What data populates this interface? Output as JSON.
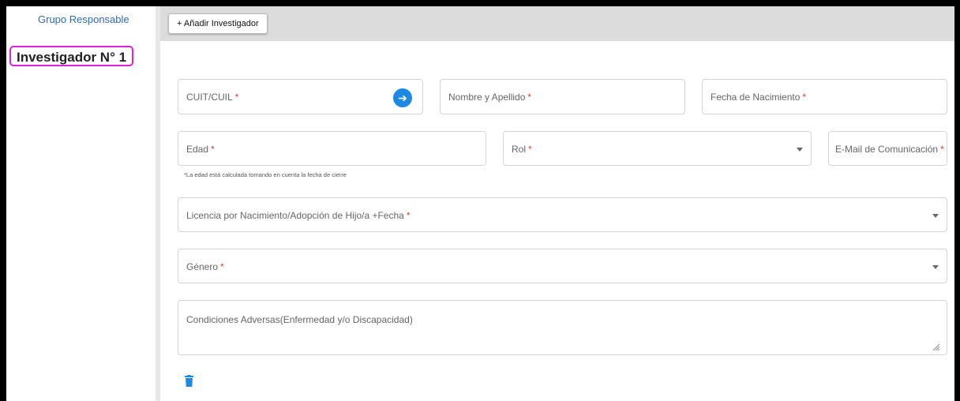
{
  "sidebar": {
    "link_label": "Grupo Responsable"
  },
  "toolbar": {
    "add_label": "+ Añadir Investigador"
  },
  "section": {
    "title": "Investigador N° 1"
  },
  "fields": {
    "cuit": {
      "label": "CUIT/CUIL",
      "required_mark": "*"
    },
    "nombre": {
      "label": "Nombre y Apellido",
      "required_mark": "*"
    },
    "fecha_nac": {
      "label": "Fecha de Nacimiento",
      "required_mark": "*"
    },
    "edad": {
      "label": "Edad",
      "required_mark": "*",
      "hint": "*La edad está calculada tomando en cuenta la fecha de cierre"
    },
    "rol": {
      "label": "Rol",
      "required_mark": "*"
    },
    "email": {
      "label": "E-Mail de Comunicación",
      "required_mark": "*"
    },
    "licencia": {
      "label": "Licencia por Nacimiento/Adopción de Hijo/a +Fecha",
      "required_mark": "*"
    },
    "genero": {
      "label": "Género",
      "required_mark": "*"
    },
    "condiciones": {
      "label": "Condiciones Adversas(Enfermedad y/o Discapacidad)"
    }
  },
  "icons": {
    "arrow": "arrow-right-icon",
    "dropdown": "chevron-down-icon",
    "delete": "trash-icon",
    "resize": "resize-handle-icon"
  },
  "colors": {
    "accent": "#1e88e5",
    "link": "#2a6db8",
    "required": "#e53935",
    "highlight": "#e020e0"
  }
}
